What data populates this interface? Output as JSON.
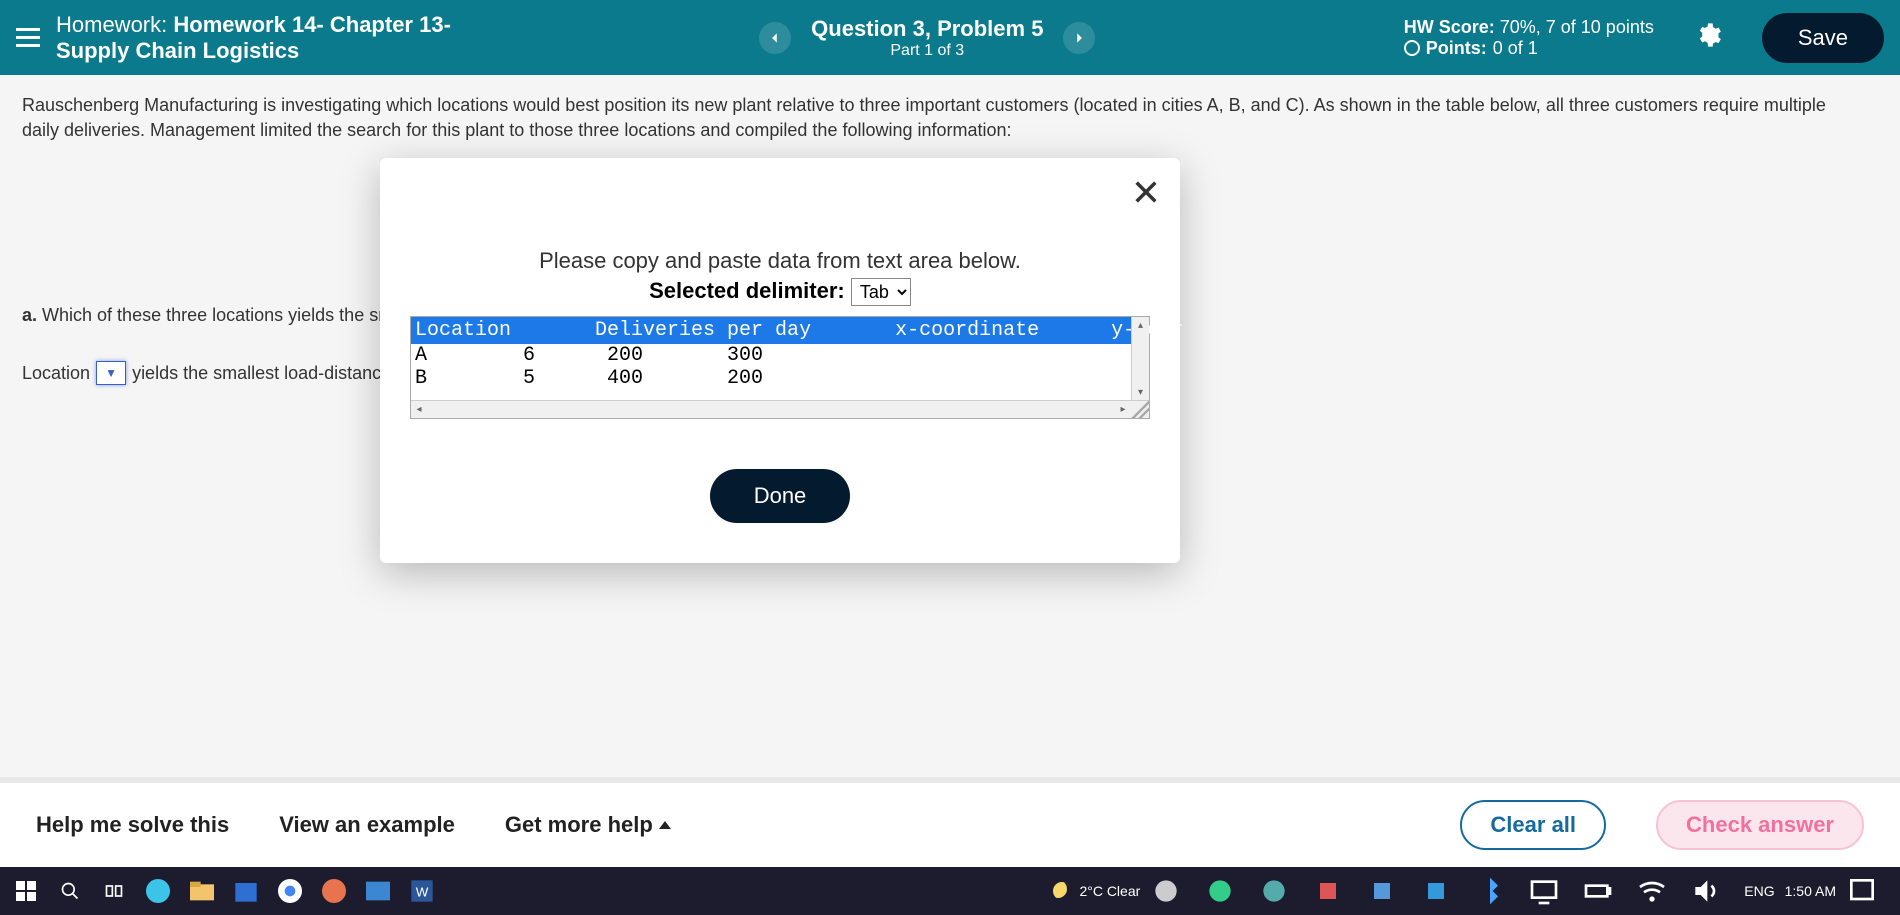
{
  "header": {
    "homework_label": "Homework:",
    "homework_title_line1": "Homework 14- Chapter 13-",
    "homework_title_line2": "Supply Chain Logistics",
    "question_title": "Question 3, Problem 5",
    "part_text": "Part 1 of 3",
    "hw_score_label": "HW Score:",
    "hw_score_value": "70%, 7 of 10 points",
    "points_label": "Points:",
    "points_value": "0 of 1",
    "save_label": "Save"
  },
  "problem": {
    "text": "Rauschenberg Manufacturing is investigating which locations would best position its new plant relative to three important customers (located in cities A, B, and C). As shown in the table below, all three customers require multiple daily deliveries. Management limited the search for this plant to those three locations and compiled the following information:",
    "part_a_prefix": "a.",
    "part_a_text": "Which of these three locations yields the smalles",
    "location_label": "Location",
    "location_tail": "yields the smallest load-distance sco"
  },
  "modal": {
    "instruction": "Please copy and paste data from text area below.",
    "delimiter_label": "Selected delimiter:",
    "delimiter_value": "Tab",
    "data_header": "Location       Deliveries per day       x-coordinate      y-coor",
    "data_rows": "A        6      200       300\nB        5      400       200",
    "done_label": "Done"
  },
  "footer": {
    "help_solve": "Help me solve this",
    "view_example": "View an example",
    "get_more_help": "Get more help",
    "clear_all": "Clear all",
    "check_answer": "Check answer"
  },
  "taskbar": {
    "weather": "2°C Clear",
    "lang": "ENG",
    "time": "1:50 AM"
  }
}
